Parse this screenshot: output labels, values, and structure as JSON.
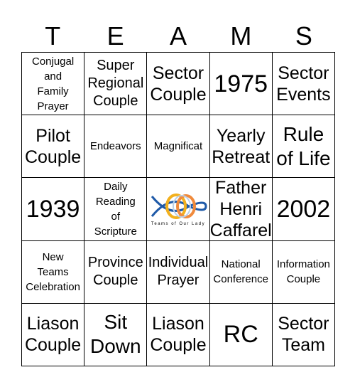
{
  "header": [
    "T",
    "E",
    "A",
    "M",
    "S"
  ],
  "cells": [
    "Conjugal\nand\nFamily\nPrayer",
    "Super\nRegional\nCouple",
    "Sector\nCouple",
    "1975",
    "Sector\nEvents",
    "Pilot\nCouple",
    "Endeavors",
    "Magnificat",
    "Yearly\nRetreat",
    "Rule\nof Life",
    "1939",
    "Daily\nReading\nof\nScripture",
    "",
    "Father\nHenri\nCaffarel",
    "2002",
    "New\nTeams\nCelebration",
    "Province\nCouple",
    "Individual\nPrayer",
    "National\nConference",
    "Information\nCouple",
    "Liason\nCouple",
    "Sit\nDown",
    "Liason\nCouple",
    "RC",
    "Sector\nTeam"
  ],
  "logo": {
    "text": "Teams of Our Lady",
    "colors": {
      "fish": "#1f5aa8",
      "yellow": "#f2b01e",
      "orange": "#f08a3c"
    }
  }
}
